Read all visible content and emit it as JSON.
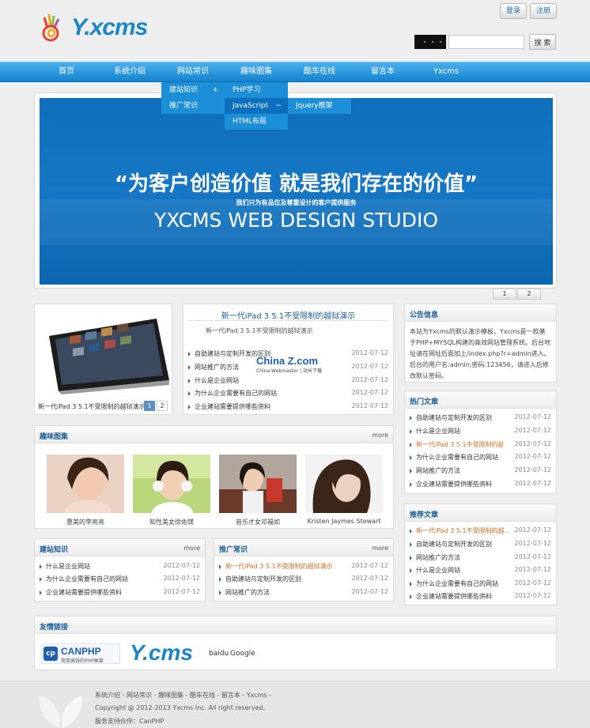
{
  "header": {
    "logo_text": "Y.xcms",
    "login_label": "登录",
    "register_label": "注册",
    "search_placeholder": "",
    "search_button": "搜 索"
  },
  "nav": {
    "items": [
      "首页",
      "系统介绍",
      "网站常识",
      "趣味图集",
      "酷车在线",
      "留言本",
      "Yxcms"
    ],
    "submenu": {
      "col1": [
        "建站知识",
        "推广常识"
      ],
      "col2": [
        "PHP学习",
        "JavaScript",
        "HTML布局"
      ],
      "col3": [
        "Jquery框架"
      ],
      "plus": "+",
      "minus": "−"
    }
  },
  "banner": {
    "slogan": "“为客户创造价值  就是我们存在的价值”",
    "subline": "我们只为有品位及尊重设计的客户提供服务",
    "studio": "YXCMS WEB DESIGN STUDIO",
    "pages": [
      "1",
      "2"
    ]
  },
  "ipad_panel": {
    "caption": "新一代iPad 3 5.1不受限制的越狱演示",
    "pages": [
      "1",
      "2"
    ]
  },
  "featured": {
    "title": "新一代iPad 3 5.1不受限制的越狱演示",
    "summary": "新一代iPad 3 5.1不受限制的越狱演示",
    "watermark_name": "China Z.com",
    "watermark_sub": "China Webmaster | 站长下载",
    "items": [
      {
        "title": "自助建站与定制开发的区别",
        "date": "2012-07-12"
      },
      {
        "title": "网站推广的方法",
        "date": "2012-07-12"
      },
      {
        "title": "什么是企业网站",
        "date": "2012-07-12"
      },
      {
        "title": "为什么企业需要有自己的网站",
        "date": "2012-07-12"
      },
      {
        "title": "企业建站需要提供哪些资料",
        "date": "2012-07-12"
      }
    ]
  },
  "notice": {
    "title": "公告信息",
    "text": "本站为Yxcms的默认演示模板，Yxcms是一款基于PHP+MYSQL构建的高效网站管理系统。后台地址请在网址后面加上/index.php?r=admin进入。后台的用户名:admin;密码:123456，请进入后修改默认密码。"
  },
  "hot": {
    "title": "热门文章",
    "items": [
      {
        "title": "自助建站与定制开发的区别",
        "date": "2012-07-12"
      },
      {
        "title": "什么是企业网站",
        "date": "2012-07-12"
      },
      {
        "title": "新一代iPad 3 5.1不受限制的越...",
        "date": "2012-07-12"
      },
      {
        "title": "为什么企业需要有自己的网站",
        "date": "2012-07-12"
      },
      {
        "title": "网站推广的方法",
        "date": "2012-07-12"
      },
      {
        "title": "企业建站需要提供哪些资料",
        "date": "2012-07-12"
      }
    ]
  },
  "recommend": {
    "title": "推荐文章",
    "items": [
      {
        "title": "新一代iPad 3 5.1不受限制的越...",
        "date": "2012-07-12"
      },
      {
        "title": "自助建站与定制开发的区别",
        "date": "2012-07-12"
      },
      {
        "title": "网站推广的方法",
        "date": "2012-07-12"
      },
      {
        "title": "什么是企业网站",
        "date": "2012-07-12"
      },
      {
        "title": "为什么企业需要有自己的网站",
        "date": "2012-07-12"
      },
      {
        "title": "企业建站需要提供哪些资料",
        "date": "2012-07-12"
      }
    ]
  },
  "gallery": {
    "title": "趣味图集",
    "more": "more",
    "photos": [
      "惠美的李亮亮",
      "知性美女徐佑镁",
      "音乐才女邓福如",
      "Kristen Jaymes Stewart"
    ]
  },
  "jianzhan": {
    "title": "建站知识",
    "more": "more",
    "items": [
      {
        "title": "什么是企业网站",
        "date": "2012-07-12"
      },
      {
        "title": "为什么企业需要有自己的网站",
        "date": "2012-07-12"
      },
      {
        "title": "企业建站需要提供哪些资料",
        "date": "2012-07-12"
      }
    ]
  },
  "tuiguang": {
    "title": "推广常识",
    "more": "more",
    "items": [
      {
        "title": "新一代iPad 3 5.1不受限制的越狱演示",
        "date": "2012-07-12"
      },
      {
        "title": "自助建站与定制开发的区别",
        "date": "2012-07-12"
      },
      {
        "title": "网站推广的方法",
        "date": "2012-07-12"
      }
    ]
  },
  "links": {
    "title": "友情链接",
    "canphp": "CANPHP",
    "canphp_sub": "简单高效的PHP框架",
    "yxcms": "Y.cms",
    "text_links": [
      "baidu",
      "Google"
    ]
  },
  "footer": {
    "nav_line": "系统介绍 - 网站常识 - 趣味图集 - 酷车在线 - 留言本 - Yxcms -",
    "copyright": "Copyright @ 2012-2013 Yxcms Inc. All right reserved.",
    "partner": "服务支持伙伴：CanPHP"
  },
  "colors": {
    "nav_blue": "#1583cf",
    "banner_blue": "#0f6fbc",
    "title_blue": "#1b5d96",
    "highlight_orange": "#d07020"
  }
}
